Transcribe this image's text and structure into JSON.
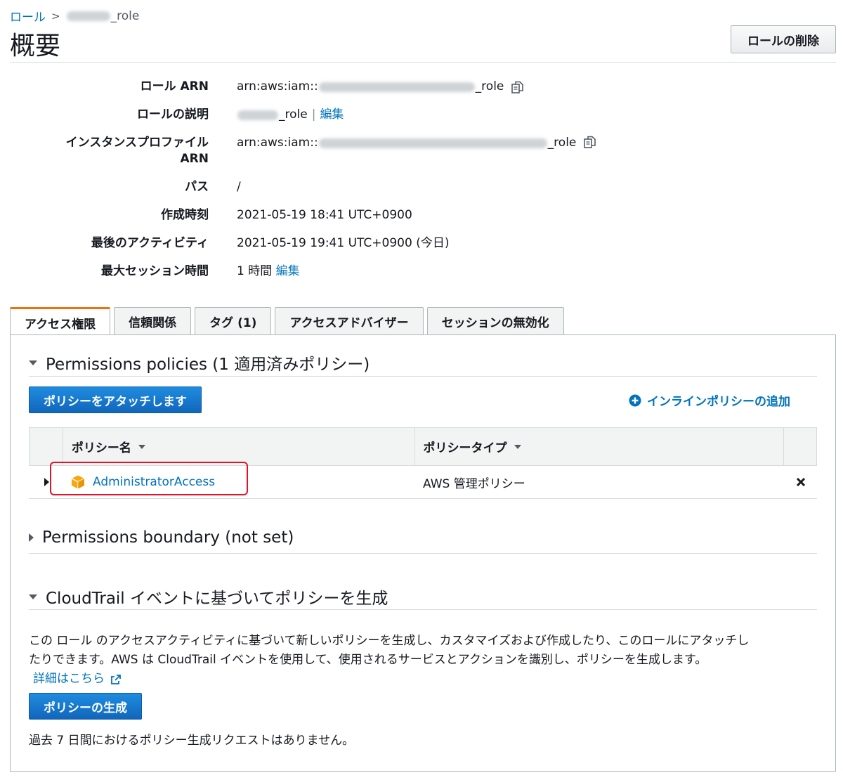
{
  "breadcrumb": {
    "root": "ロール",
    "current_suffix": "_role"
  },
  "page": {
    "title": "概要",
    "delete_button": "ロールの削除"
  },
  "summary": {
    "role_arn": {
      "label": "ロール ARN",
      "prefix": "arn:aws:iam::",
      "suffix": "_role"
    },
    "description": {
      "label": "ロールの説明",
      "suffix": "_role",
      "separator": "|",
      "edit": "編集"
    },
    "instance_profile_arn": {
      "label_line1": "インスタンスプロファイル",
      "label_line2": "ARN",
      "prefix": "arn:aws:iam::",
      "suffix": "_role"
    },
    "path": {
      "label": "パス",
      "value": "/"
    },
    "created": {
      "label": "作成時刻",
      "value": "2021-05-19 18:41 UTC+0900"
    },
    "last_activity": {
      "label": "最後のアクティビティ",
      "value": "2021-05-19 19:41 UTC+0900 (今日)"
    },
    "max_session": {
      "label": "最大セッション時間",
      "value": "1 時間",
      "edit": "編集"
    }
  },
  "tabs": [
    {
      "label": "アクセス権限",
      "active": true
    },
    {
      "label": "信頼関係",
      "active": false
    },
    {
      "label": "タグ (1)",
      "active": false
    },
    {
      "label": "アクセスアドバイザー",
      "active": false
    },
    {
      "label": "セッションの無効化",
      "active": false
    }
  ],
  "permissions": {
    "heading": "Permissions policies (1 適用済みポリシー)",
    "attach_button": "ポリシーをアタッチします",
    "add_inline": "インラインポリシーの追加",
    "columns": [
      "ポリシー名",
      "ポリシータイプ"
    ],
    "rows": [
      {
        "name": "AdministratorAccess",
        "type": "AWS 管理ポリシー"
      }
    ]
  },
  "boundary": {
    "heading": "Permissions boundary (not set)"
  },
  "cloudtrail": {
    "heading": "CloudTrail イベントに基づいてポリシーを生成",
    "description_line1": "この ロール のアクセスアクティビティに基づいて新しいポリシーを生成し、カスタマイズおよび作成したり、このロールにアタッチし",
    "description_line2": "たりできます。AWS は CloudTrail イベントを使用して、使用されるサービスとアクションを識別し、ポリシーを生成します。",
    "learn_more": "詳細はこちら",
    "generate_button": "ポリシーの生成",
    "no_requests": "過去 7 日間におけるポリシー生成リクエストはありません。"
  },
  "colors": {
    "link": "#0073bb",
    "primary_button": "#1166bb",
    "active_tab_accent": "#ec7211",
    "highlight_box": "#e0142b",
    "aws_cube": "#f7a80d"
  }
}
